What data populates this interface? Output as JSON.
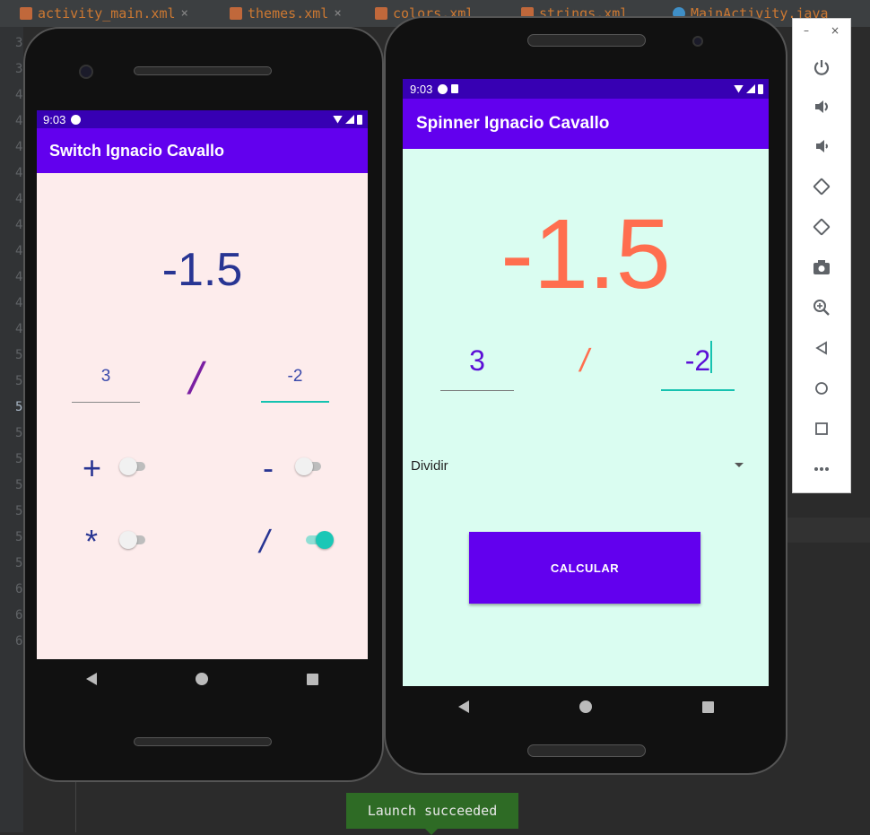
{
  "ide": {
    "tabs": [
      {
        "label": "activity_main.xml"
      },
      {
        "label": "themes.xml"
      },
      {
        "label": "colors.xml"
      },
      {
        "label": "strings.xml"
      },
      {
        "label": "MainActivity.java"
      }
    ],
    "line_numbers": [
      "3",
      "3",
      "4",
      "4",
      "4",
      "4",
      "4",
      "4",
      "4",
      "4",
      "4",
      "4",
      "5",
      "5",
      "5",
      "5",
      "5",
      "5",
      "5",
      "5",
      "5",
      "6",
      "6",
      "6"
    ],
    "active_line_index": 14
  },
  "phone_left": {
    "status_time": "9:03",
    "app_title": "Switch Ignacio Cavallo",
    "result": "-1.5",
    "operand1": "3",
    "operand2": "-2",
    "operator_display": "/",
    "operators": [
      {
        "symbol": "+",
        "checked": false
      },
      {
        "symbol": "-",
        "checked": false
      },
      {
        "symbol": "*",
        "checked": false
      },
      {
        "symbol": "/",
        "checked": true
      }
    ]
  },
  "phone_right": {
    "status_time": "9:03",
    "app_title": "Spinner Ignacio Cavallo",
    "result": "-1.5",
    "operand1": "3",
    "operand2": "-2",
    "operator_display": "/",
    "spinner_value": "Dividir",
    "button_label": "CALCULAR"
  },
  "emulator_toolbar": {
    "minimize": "–",
    "close": "×",
    "buttons": [
      "power-icon",
      "volume-up-icon",
      "volume-down-icon",
      "rotate-left-icon",
      "rotate-right-icon",
      "camera-icon",
      "zoom-icon",
      "back-icon",
      "home-icon",
      "overview-icon",
      "more-icon"
    ]
  },
  "toast": "Launch succeeded",
  "colors": {
    "primary": "#6200ee",
    "primary_dark": "#3700b3",
    "accent": "#16c2b0",
    "result_right": "#ff6e4f",
    "result_left": "#283593"
  }
}
